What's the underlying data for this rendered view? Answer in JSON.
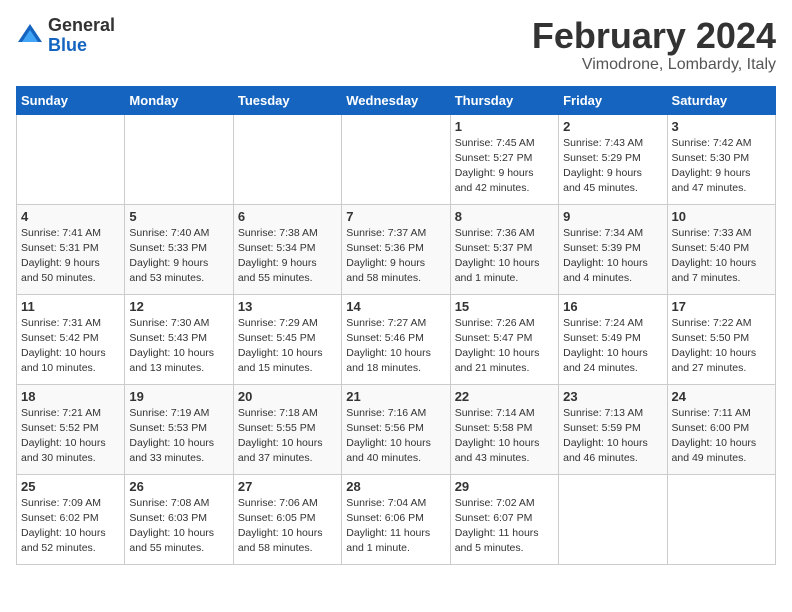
{
  "header": {
    "logo_general": "General",
    "logo_blue": "Blue",
    "month_title": "February 2024",
    "location": "Vimodrone, Lombardy, Italy"
  },
  "weekdays": [
    "Sunday",
    "Monday",
    "Tuesday",
    "Wednesday",
    "Thursday",
    "Friday",
    "Saturday"
  ],
  "weeks": [
    [
      {
        "day": "",
        "info": ""
      },
      {
        "day": "",
        "info": ""
      },
      {
        "day": "",
        "info": ""
      },
      {
        "day": "",
        "info": ""
      },
      {
        "day": "1",
        "info": "Sunrise: 7:45 AM\nSunset: 5:27 PM\nDaylight: 9 hours\nand 42 minutes."
      },
      {
        "day": "2",
        "info": "Sunrise: 7:43 AM\nSunset: 5:29 PM\nDaylight: 9 hours\nand 45 minutes."
      },
      {
        "day": "3",
        "info": "Sunrise: 7:42 AM\nSunset: 5:30 PM\nDaylight: 9 hours\nand 47 minutes."
      }
    ],
    [
      {
        "day": "4",
        "info": "Sunrise: 7:41 AM\nSunset: 5:31 PM\nDaylight: 9 hours\nand 50 minutes."
      },
      {
        "day": "5",
        "info": "Sunrise: 7:40 AM\nSunset: 5:33 PM\nDaylight: 9 hours\nand 53 minutes."
      },
      {
        "day": "6",
        "info": "Sunrise: 7:38 AM\nSunset: 5:34 PM\nDaylight: 9 hours\nand 55 minutes."
      },
      {
        "day": "7",
        "info": "Sunrise: 7:37 AM\nSunset: 5:36 PM\nDaylight: 9 hours\nand 58 minutes."
      },
      {
        "day": "8",
        "info": "Sunrise: 7:36 AM\nSunset: 5:37 PM\nDaylight: 10 hours\nand 1 minute."
      },
      {
        "day": "9",
        "info": "Sunrise: 7:34 AM\nSunset: 5:39 PM\nDaylight: 10 hours\nand 4 minutes."
      },
      {
        "day": "10",
        "info": "Sunrise: 7:33 AM\nSunset: 5:40 PM\nDaylight: 10 hours\nand 7 minutes."
      }
    ],
    [
      {
        "day": "11",
        "info": "Sunrise: 7:31 AM\nSunset: 5:42 PM\nDaylight: 10 hours\nand 10 minutes."
      },
      {
        "day": "12",
        "info": "Sunrise: 7:30 AM\nSunset: 5:43 PM\nDaylight: 10 hours\nand 13 minutes."
      },
      {
        "day": "13",
        "info": "Sunrise: 7:29 AM\nSunset: 5:45 PM\nDaylight: 10 hours\nand 15 minutes."
      },
      {
        "day": "14",
        "info": "Sunrise: 7:27 AM\nSunset: 5:46 PM\nDaylight: 10 hours\nand 18 minutes."
      },
      {
        "day": "15",
        "info": "Sunrise: 7:26 AM\nSunset: 5:47 PM\nDaylight: 10 hours\nand 21 minutes."
      },
      {
        "day": "16",
        "info": "Sunrise: 7:24 AM\nSunset: 5:49 PM\nDaylight: 10 hours\nand 24 minutes."
      },
      {
        "day": "17",
        "info": "Sunrise: 7:22 AM\nSunset: 5:50 PM\nDaylight: 10 hours\nand 27 minutes."
      }
    ],
    [
      {
        "day": "18",
        "info": "Sunrise: 7:21 AM\nSunset: 5:52 PM\nDaylight: 10 hours\nand 30 minutes."
      },
      {
        "day": "19",
        "info": "Sunrise: 7:19 AM\nSunset: 5:53 PM\nDaylight: 10 hours\nand 33 minutes."
      },
      {
        "day": "20",
        "info": "Sunrise: 7:18 AM\nSunset: 5:55 PM\nDaylight: 10 hours\nand 37 minutes."
      },
      {
        "day": "21",
        "info": "Sunrise: 7:16 AM\nSunset: 5:56 PM\nDaylight: 10 hours\nand 40 minutes."
      },
      {
        "day": "22",
        "info": "Sunrise: 7:14 AM\nSunset: 5:58 PM\nDaylight: 10 hours\nand 43 minutes."
      },
      {
        "day": "23",
        "info": "Sunrise: 7:13 AM\nSunset: 5:59 PM\nDaylight: 10 hours\nand 46 minutes."
      },
      {
        "day": "24",
        "info": "Sunrise: 7:11 AM\nSunset: 6:00 PM\nDaylight: 10 hours\nand 49 minutes."
      }
    ],
    [
      {
        "day": "25",
        "info": "Sunrise: 7:09 AM\nSunset: 6:02 PM\nDaylight: 10 hours\nand 52 minutes."
      },
      {
        "day": "26",
        "info": "Sunrise: 7:08 AM\nSunset: 6:03 PM\nDaylight: 10 hours\nand 55 minutes."
      },
      {
        "day": "27",
        "info": "Sunrise: 7:06 AM\nSunset: 6:05 PM\nDaylight: 10 hours\nand 58 minutes."
      },
      {
        "day": "28",
        "info": "Sunrise: 7:04 AM\nSunset: 6:06 PM\nDaylight: 11 hours\nand 1 minute."
      },
      {
        "day": "29",
        "info": "Sunrise: 7:02 AM\nSunset: 6:07 PM\nDaylight: 11 hours\nand 5 minutes."
      },
      {
        "day": "",
        "info": ""
      },
      {
        "day": "",
        "info": ""
      }
    ]
  ]
}
